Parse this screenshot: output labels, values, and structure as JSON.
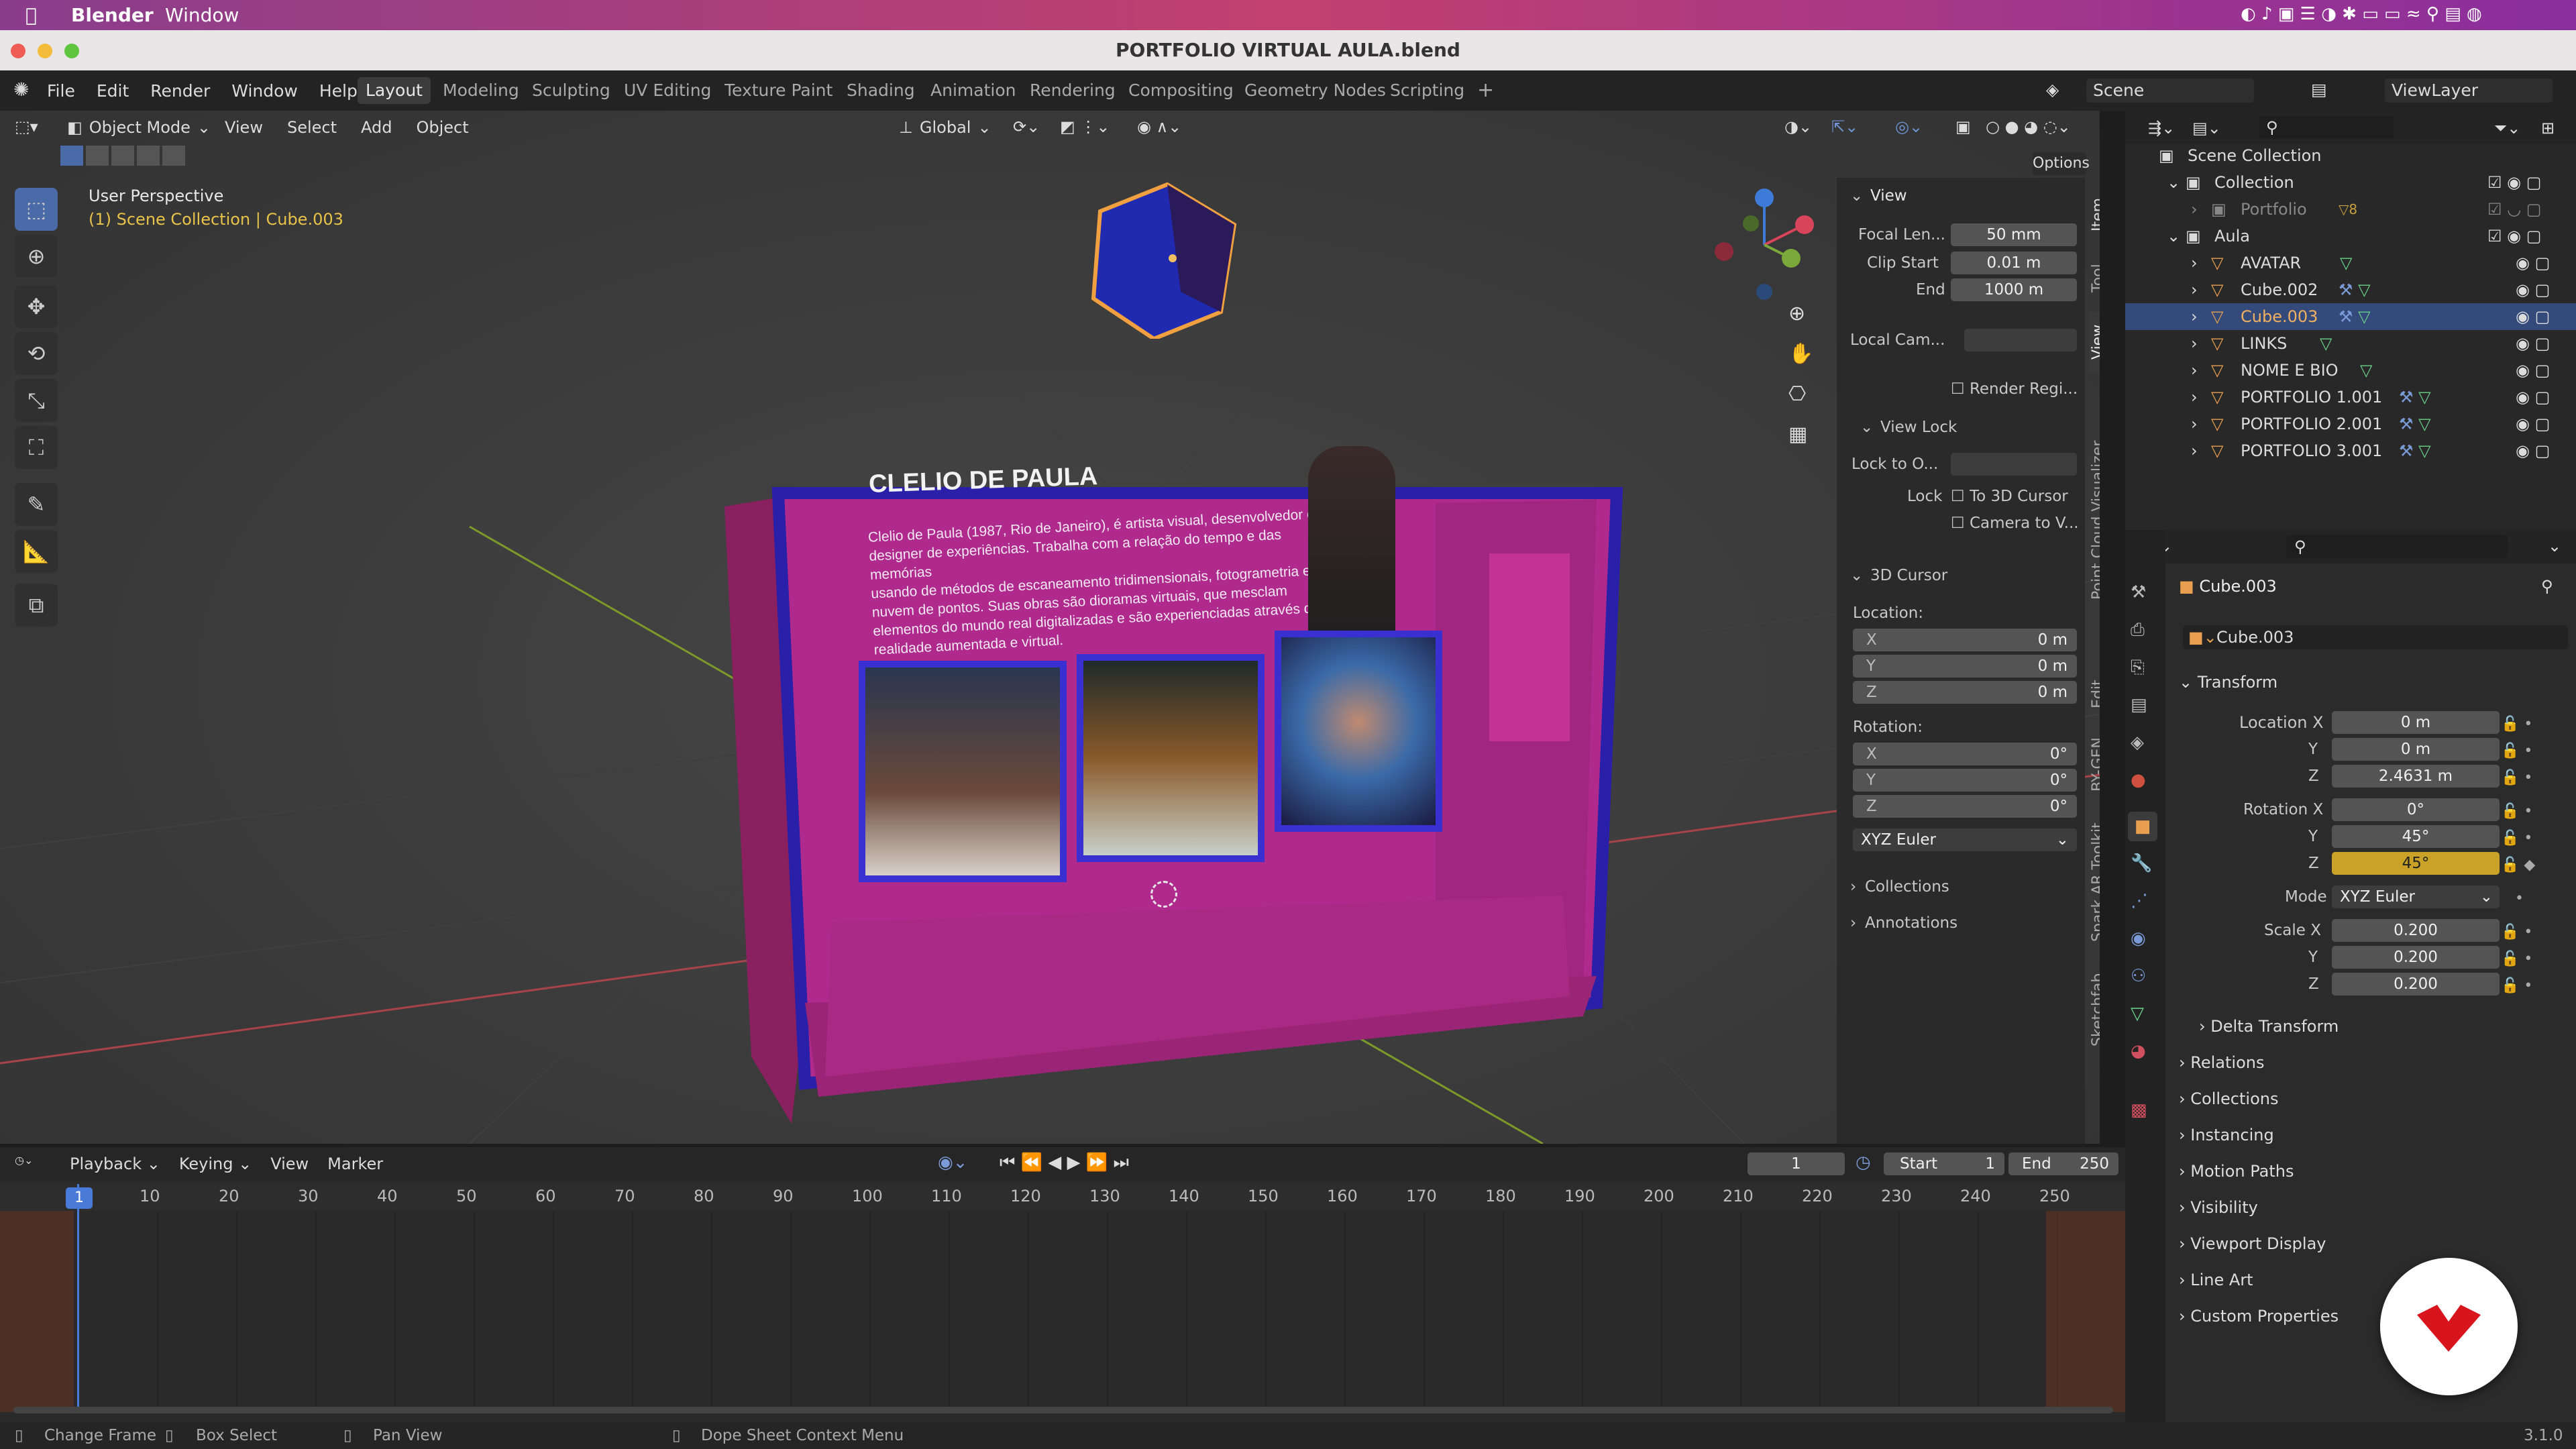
{
  "mac_menu": {
    "app": "Blender",
    "window": "Window"
  },
  "title": "PORTFOLIO VIRTUAL AULA.blend",
  "menus": [
    "File",
    "Edit",
    "Render",
    "Window",
    "Help"
  ],
  "workspaces": [
    "Layout",
    "Modeling",
    "Sculpting",
    "UV Editing",
    "Texture Paint",
    "Shading",
    "Animation",
    "Rendering",
    "Compositing",
    "Geometry Nodes",
    "Scripting"
  ],
  "active_workspace": "Layout",
  "scene": "Scene",
  "view_layer": "ViewLayer",
  "viewport": {
    "mode": "Object Mode",
    "menus": [
      "View",
      "Select",
      "Add",
      "Object"
    ],
    "transform": "Global",
    "options": "Options",
    "overlay_title": "User Perspective",
    "overlay_sub": "(1) Scene Collection | Cube.003"
  },
  "scene_panel": {
    "name": "CLELIO DE PAULA",
    "bio": [
      "Clelio de Paula (1987, Rio de Janeiro), é artista visual, desenvolvedor e",
      "designer de experiências. Trabalha com a relação do tempo e das memórias",
      "usando de métodos de escaneamento tridimensionais, fotogrametria e",
      "nuvem de pontos. Suas obras são dioramas virtuais, que mesclam",
      "elementos do mundo real digitalizadas e são experienciadas através de",
      "realidade aumentada e virtual."
    ]
  },
  "npanel": {
    "view_title": "View",
    "focal_label": "Focal Len...",
    "focal": "50 mm",
    "clip_start_label": "Clip Start",
    "clip_start": "0.01 m",
    "end_label": "End",
    "end": "1000 m",
    "local_cam": "Local Cam...",
    "render_region": "Render Regi...",
    "view_lock": "View Lock",
    "lock_to": "Lock to O...",
    "lock": "Lock",
    "to_cursor": "To 3D Cursor",
    "camera_to_v": "Camera to V...",
    "cursor_title": "3D Cursor",
    "location": "Location:",
    "rotation": "Rotation:",
    "loc": [
      "0 m",
      "0 m",
      "0 m"
    ],
    "rot": [
      "0°",
      "0°",
      "0°"
    ],
    "axes": [
      "X",
      "Y",
      "Z"
    ],
    "rot_mode": "XYZ Euler",
    "collections": "Collections",
    "annotations": "Annotations"
  },
  "side_tabs": [
    "Item",
    "Tool",
    "View",
    "Point Cloud Visualizer",
    "Edit",
    "BY-GEN",
    "Spark AR Toolkit",
    "Sketchfab"
  ],
  "outliner": {
    "root": "Scene Collection",
    "items": [
      {
        "name": "Collection",
        "indent": 1
      },
      {
        "name": "Portfolio",
        "indent": 2,
        "dim": true
      },
      {
        "name": "Aula",
        "indent": 1
      },
      {
        "name": "AVATAR",
        "indent": 2
      },
      {
        "name": "Cube.002",
        "indent": 2
      },
      {
        "name": "Cube.003",
        "indent": 2,
        "selected": true
      },
      {
        "name": "LINKS",
        "indent": 2
      },
      {
        "name": "NOME E BIO",
        "indent": 2
      },
      {
        "name": "PORTFOLIO 1.001",
        "indent": 2
      },
      {
        "name": "PORTFOLIO 2.001",
        "indent": 2
      },
      {
        "name": "PORTFOLIO 3.001",
        "indent": 2
      }
    ],
    "badge": "8"
  },
  "properties": {
    "object": "Cube.003",
    "object_field": "Cube.003",
    "transform": "Transform",
    "location_x_label": "Location X",
    "location": [
      "0 m",
      "0 m",
      "2.4631 m"
    ],
    "rotation_x_label": "Rotation X",
    "rotation": [
      "0°",
      "45°",
      "45°"
    ],
    "mode_label": "Mode",
    "mode": "XYZ Euler",
    "scale_x_label": "Scale X",
    "scale": [
      "0.200",
      "0.200",
      "0.200"
    ],
    "y": "Y",
    "z": "Z",
    "delta": "Delta Transform",
    "sections": [
      "Relations",
      "Collections",
      "Instancing",
      "Motion Paths",
      "Visibility",
      "Viewport Display",
      "Line Art",
      "Custom Properties"
    ]
  },
  "timeline": {
    "menus": [
      "Playback",
      "Keying",
      "View",
      "Marker"
    ],
    "current": "1",
    "start_label": "Start",
    "start": "1",
    "end_label": "End",
    "end": "250",
    "ticks": [
      "1",
      "10",
      "20",
      "30",
      "40",
      "50",
      "60",
      "70",
      "80",
      "90",
      "100",
      "110",
      "120",
      "130",
      "140",
      "150",
      "160",
      "170",
      "180",
      "190",
      "200",
      "210",
      "220",
      "230",
      "240",
      "250"
    ]
  },
  "status": {
    "change_frame": "Change Frame",
    "box_select": "Box Select",
    "pan_view": "Pan View",
    "context": "Dope Sheet Context Menu",
    "version": "3.1.0"
  },
  "colors": {
    "accent": "#4a6aa8",
    "magenta": "#b02a8e",
    "frame": "#2a1fa8",
    "keyframe": "#c9a227"
  }
}
